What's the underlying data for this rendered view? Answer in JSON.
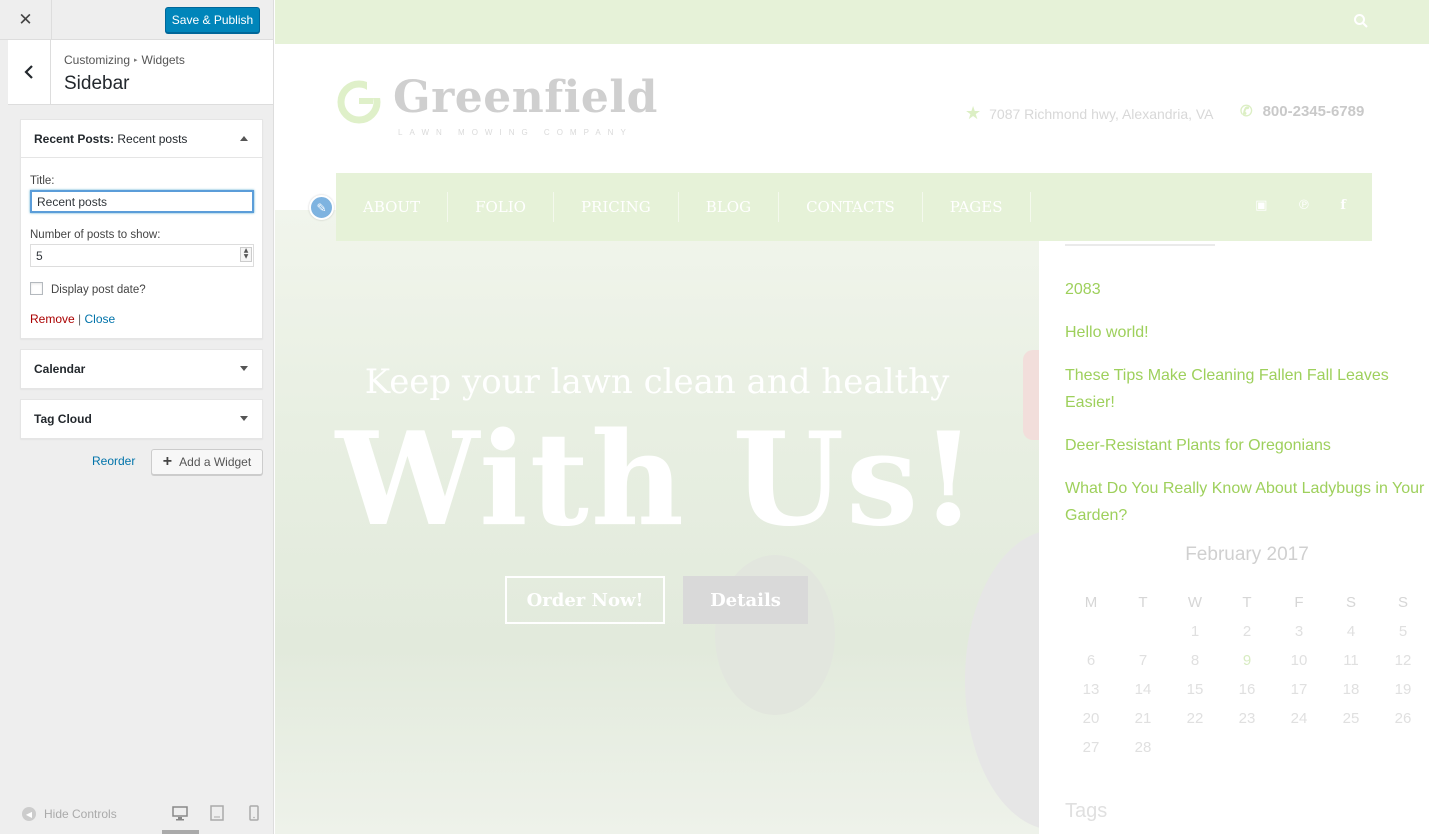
{
  "customizer": {
    "close_icon": "close-icon",
    "publish_label": "Save & Publish",
    "breadcrumb": [
      "Customizing",
      "Widgets"
    ],
    "breadcrumb_sep": "▸",
    "section_title": "Sidebar",
    "widgets": [
      {
        "title": "Recent Posts",
        "subtitle": "Recent posts",
        "expanded": true,
        "fields": {
          "title_label": "Title:",
          "title_value": "Recent posts",
          "number_label": "Number of posts to show:",
          "number_value": "5",
          "date_label": "Display post date?",
          "date_checked": false
        },
        "remove_label": "Remove",
        "pipe": "|",
        "close_label": "Close"
      },
      {
        "title": "Calendar",
        "expanded": false
      },
      {
        "title": "Tag Cloud",
        "expanded": false
      }
    ],
    "reorder_label": "Reorder",
    "add_widget_label": "Add a Widget",
    "hide_controls_label": "Hide Controls",
    "devices": [
      "desktop",
      "tablet",
      "mobile"
    ],
    "active_device": "desktop"
  },
  "preview": {
    "logo_text": "Greenfield",
    "logo_sub": "LAWN MOWING COMPANY",
    "address": "7087 Richmond hwy, Alexandria, VA",
    "phone": "800-2345-6789",
    "nav": [
      "ABOUT",
      "FOLIO",
      "PRICING",
      "BLOG",
      "CONTACTS",
      "PAGES"
    ],
    "social_icons": [
      "instagram-icon",
      "pinterest-icon",
      "facebook-icon"
    ],
    "hero_subtitle": "Keep your lawn clean and healthy",
    "hero_title": "With Us!",
    "order_label": "Order Now!",
    "details_label": "Details",
    "recent_posts": [
      "2083",
      "Hello world!",
      "These Tips Make Cleaning Fallen Fall Leaves Easier!",
      "Deer-Resistant Plants for Oregonians",
      "What Do You Really Know About Ladybugs in Your Garden?"
    ],
    "calendar": {
      "title": "February 2017",
      "days": [
        "M",
        "T",
        "W",
        "T",
        "F",
        "S",
        "S"
      ],
      "weeks": [
        [
          "",
          "",
          "1",
          "2",
          "3",
          "4",
          "5"
        ],
        [
          "6",
          "7",
          "8",
          "9",
          "10",
          "11",
          "12"
        ],
        [
          "13",
          "14",
          "15",
          "16",
          "17",
          "18",
          "19"
        ],
        [
          "20",
          "21",
          "22",
          "23",
          "24",
          "25",
          "26"
        ],
        [
          "27",
          "28",
          "",
          "",
          "",
          "",
          ""
        ]
      ],
      "today": "9"
    },
    "tags_title": "Tags"
  },
  "colors": {
    "publish_blue": "#0085ba",
    "link_blue": "#0073aa",
    "remove_red": "#aa0000",
    "brand_green": "#9ed05c",
    "light_green_bar": "#e6f2d8"
  }
}
